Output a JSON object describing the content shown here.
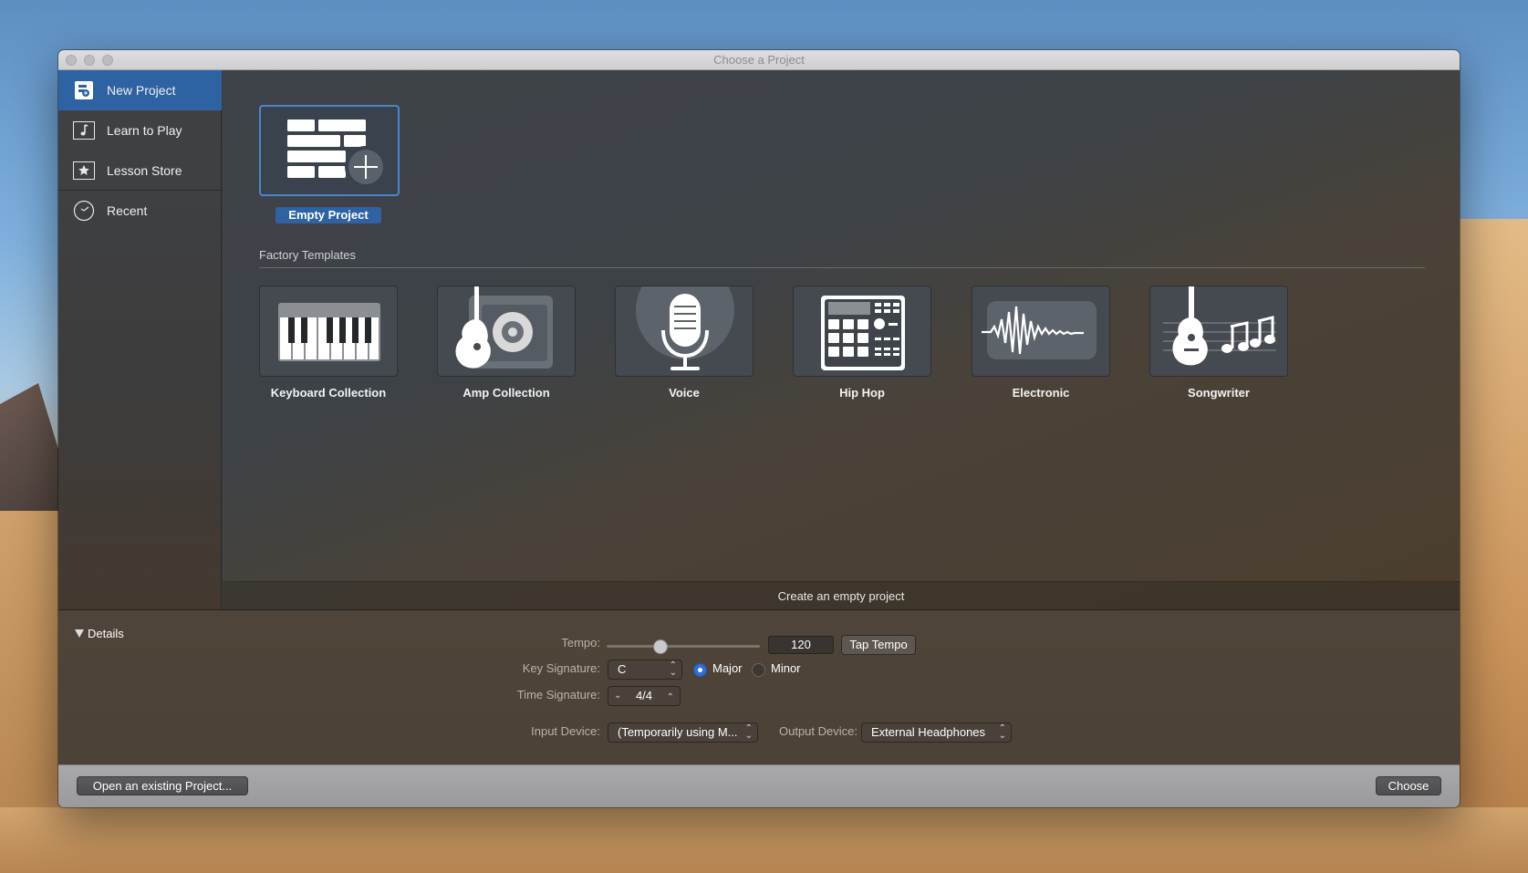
{
  "window": {
    "title": "Choose a Project"
  },
  "sidebar": {
    "items": [
      {
        "label": "New Project",
        "icon": "new-project-icon",
        "selected": true
      },
      {
        "label": "Learn to Play",
        "icon": "music-note-icon",
        "selected": false
      },
      {
        "label": "Lesson Store",
        "icon": "star-icon",
        "selected": false
      },
      {
        "label": "Recent",
        "icon": "clock-icon",
        "selected": false
      }
    ]
  },
  "main": {
    "empty_project": {
      "label": "Empty Project"
    },
    "section_title": "Factory Templates",
    "templates": [
      {
        "label": "Keyboard Collection",
        "icon": "piano-keys-icon"
      },
      {
        "label": "Amp Collection",
        "icon": "guitar-amp-icon"
      },
      {
        "label": "Voice",
        "icon": "microphone-icon"
      },
      {
        "label": "Hip Hop",
        "icon": "drum-machine-icon"
      },
      {
        "label": "Electronic",
        "icon": "waveform-icon"
      },
      {
        "label": "Songwriter",
        "icon": "acoustic-guitar-notes-icon"
      }
    ],
    "status": "Create an empty project"
  },
  "details": {
    "toggle_label": "Details",
    "tempo": {
      "label": "Tempo:",
      "value": "120",
      "slider_fraction": 0.35,
      "tap_label": "Tap Tempo"
    },
    "key_signature": {
      "label": "Key Signature:",
      "value": "C",
      "major_label": "Major",
      "minor_label": "Minor",
      "selected": "Major"
    },
    "time_signature": {
      "label": "Time Signature:",
      "value": "4/4"
    },
    "input_device": {
      "label": "Input Device:",
      "value": "(Temporarily using M..."
    },
    "output_device": {
      "label": "Output Device:",
      "value": "External Headphones"
    }
  },
  "footer": {
    "open_label": "Open an existing Project...",
    "choose_label": "Choose"
  },
  "colors": {
    "accent": "#2e62a3",
    "selection_border": "#4a86c9"
  }
}
